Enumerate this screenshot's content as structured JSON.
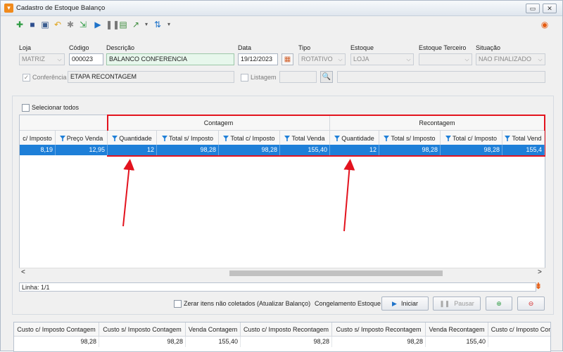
{
  "window": {
    "title": "Cadastro de Estoque Balanço",
    "minimize": "▭",
    "close": "✕"
  },
  "colors": {
    "selection": "#1e7fd8",
    "highlight_box": "#e3131e",
    "annotation_arrow": "#e3131e",
    "filter_icon": "#1e7fd8",
    "input_green": "#e7f7ec"
  },
  "header": {
    "loja_label": "Loja",
    "loja_value": "MATRIZ",
    "codigo_label": "Código",
    "codigo_value": "000023",
    "descricao_label": "Descrição",
    "descricao_value": "BALANCO CONFERENCIA",
    "data_label": "Data",
    "data_value": "19/12/2023",
    "tipo_label": "Tipo",
    "tipo_value": "ROTATIVO",
    "estoque_label": "Estoque",
    "estoque_value": "LOJA",
    "estoque_terceiro_label": "Estoque Terceiro",
    "estoque_terceiro_value": "",
    "situacao_label": "Situação",
    "situacao_value": "NAO FINALIZADO",
    "conferencia_label": "Conferência",
    "conferencia_checked": "✓",
    "conferencia_value": "ETAPA RECONTAGEM",
    "listagem_label": "Listagem",
    "listagem_value": ""
  },
  "grid": {
    "select_all_label": "Selecionar todos",
    "group_contagem": "Contagem",
    "group_recontagem": "Recontagem",
    "columns": [
      "c/ Imposto",
      "Preço Venda",
      "Quantidade",
      "Total s/ Imposto",
      "Total c/ Imposto",
      "Total Venda",
      "Quantidade",
      "Total s/ Imposto",
      "Total c/ Imposto",
      "Total Vend"
    ],
    "row": [
      "8,19",
      "12,95",
      "12",
      "98,28",
      "98,28",
      "155,40",
      "12",
      "98,28",
      "98,28",
      "155,4"
    ],
    "scroll_left": "<",
    "scroll_right": ">"
  },
  "status": {
    "linha": "Linha: 1/1"
  },
  "actions": {
    "zerar_label": "Zerar itens não coletados (Atualizar Balanço)",
    "congelamento_label": "Congelamento Estoque",
    "iniciar": "Iniciar",
    "pausar": "Pausar"
  },
  "summary": {
    "columns": [
      "Custo c/ Imposto Contagem",
      "Custo s/ Imposto Contagem",
      "Venda Contagem",
      "Custo c/ Imposto Recontagem",
      "Custo s/ Imposto Recontagem",
      "Venda Recontagem",
      "Custo c/ Imposto Con"
    ],
    "values": [
      "98,28",
      "98,28",
      "155,40",
      "98,28",
      "98,28",
      "155,40",
      ""
    ]
  }
}
